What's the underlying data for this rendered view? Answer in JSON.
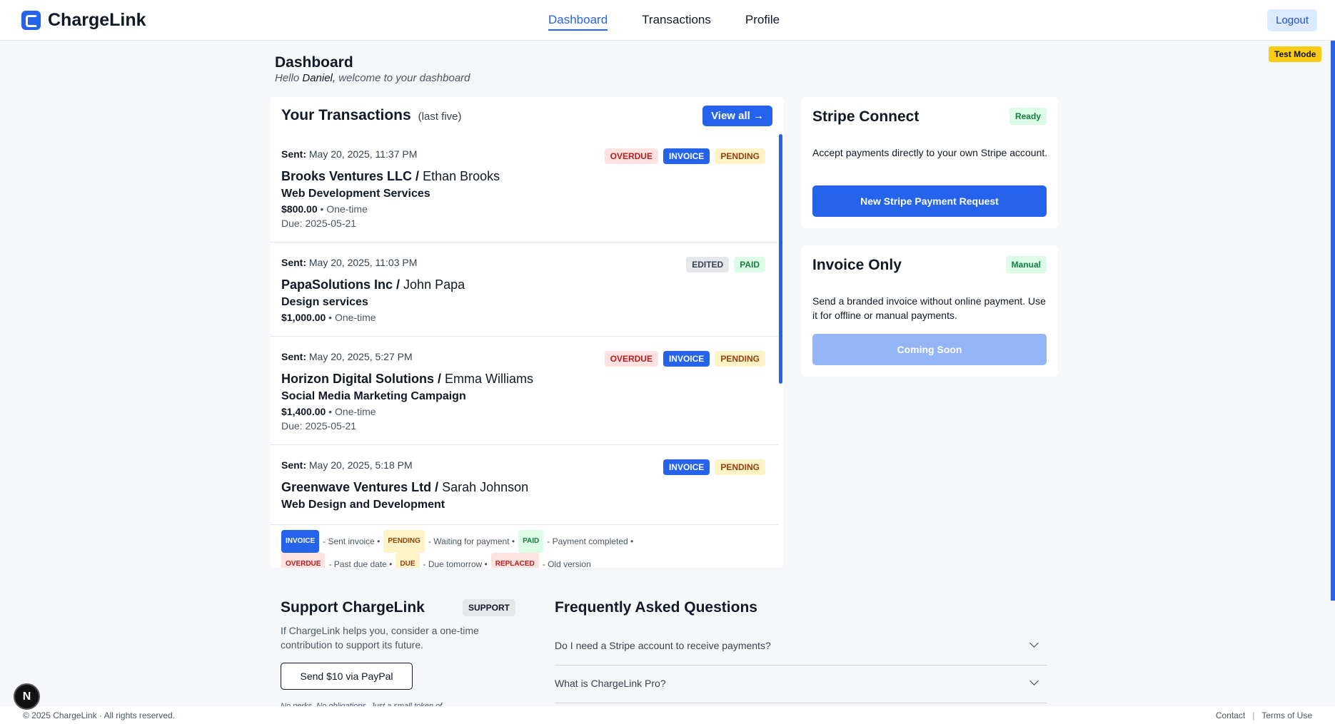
{
  "brand": {
    "name": "ChargeLink"
  },
  "nav": {
    "items": [
      "Dashboard",
      "Transactions",
      "Profile"
    ],
    "active": "Dashboard"
  },
  "header": {
    "logout_label": "Logout"
  },
  "test_mode_label": "Test Mode",
  "dashboard": {
    "title": "Dashboard",
    "greeting_prefix": "Hello",
    "user_name": "Daniel,",
    "greeting_suffix": "welcome to your dashboard"
  },
  "transactions": {
    "title": "Your Transactions",
    "subtitle": "(last five)",
    "view_all_label": "View all →",
    "sent_label": "Sent:",
    "items": [
      {
        "sent": "May 20, 2025, 11:37 PM",
        "badges": [
          "OVERDUE",
          "INVOICE",
          "PENDING"
        ],
        "company": "Brooks Ventures LLC",
        "contact": "Ethan Brooks",
        "service": "Web Development Services",
        "amount": "$800.00",
        "frequency": "One-time",
        "due": "Due: 2025-05-21"
      },
      {
        "sent": "May 20, 2025, 11:03 PM",
        "badges": [
          "EDITED",
          "PAID"
        ],
        "company": "PapaSolutions Inc",
        "contact": "John Papa",
        "service": "Design services",
        "amount": "$1,000.00",
        "frequency": "One-time",
        "due": ""
      },
      {
        "sent": "May 20, 2025, 5:27 PM",
        "badges": [
          "OVERDUE",
          "INVOICE",
          "PENDING"
        ],
        "company": "Horizon Digital Solutions",
        "contact": "Emma Williams",
        "service": "Social Media Marketing Campaign",
        "amount": "$1,400.00",
        "frequency": "One-time",
        "due": "Due: 2025-05-21"
      },
      {
        "sent": "May 20, 2025, 5:18 PM",
        "badges": [
          "INVOICE",
          "PENDING"
        ],
        "company": "Greenwave Ventures Ltd",
        "contact": "Sarah Johnson",
        "service": "Web Design and Development",
        "amount": "",
        "frequency": "",
        "due": ""
      }
    ],
    "legend": {
      "invoice": "INVOICE",
      "invoice_desc": "- Sent invoice •",
      "pending": "PENDING",
      "pending_desc": "- Waiting for payment •",
      "paid": "PAID",
      "paid_desc": "- Payment completed •",
      "overdue": "OVERDUE",
      "overdue_desc": "- Past due date •",
      "due": "DUE",
      "due_desc": "- Due tomorrow •",
      "replaced": "REPLACED",
      "replaced_desc": "- Old version"
    }
  },
  "stripe_connect": {
    "title": "Stripe Connect",
    "badge": "Ready",
    "description": "Accept payments directly to your own Stripe account.",
    "button_label": "New Stripe Payment Request"
  },
  "invoice_only": {
    "title": "Invoice Only",
    "badge": "Manual",
    "description": "Send a branded invoice without online payment. Use it for offline or manual payments.",
    "button_label": "Coming Soon"
  },
  "support": {
    "title": "Support ChargeLink",
    "badge": "SUPPORT",
    "description": "If ChargeLink helps you, consider a one-time contribution to support its future.",
    "button_label": "Send $10 via PayPal",
    "note": "No perks. No obligations. Just a small token of"
  },
  "faq": {
    "title": "Frequently Asked Questions",
    "questions": [
      "Do I need a Stripe account to receive payments?",
      "What is ChargeLink Pro?"
    ]
  },
  "footer": {
    "copyright": "© 2025 ChargeLink  ·  All rights reserved.",
    "contact": "Contact",
    "separator": "|",
    "terms": "Terms of Use"
  },
  "dev_badge": "N",
  "colors": {
    "accent": "#2563eb",
    "test_mode": "#facc15"
  }
}
